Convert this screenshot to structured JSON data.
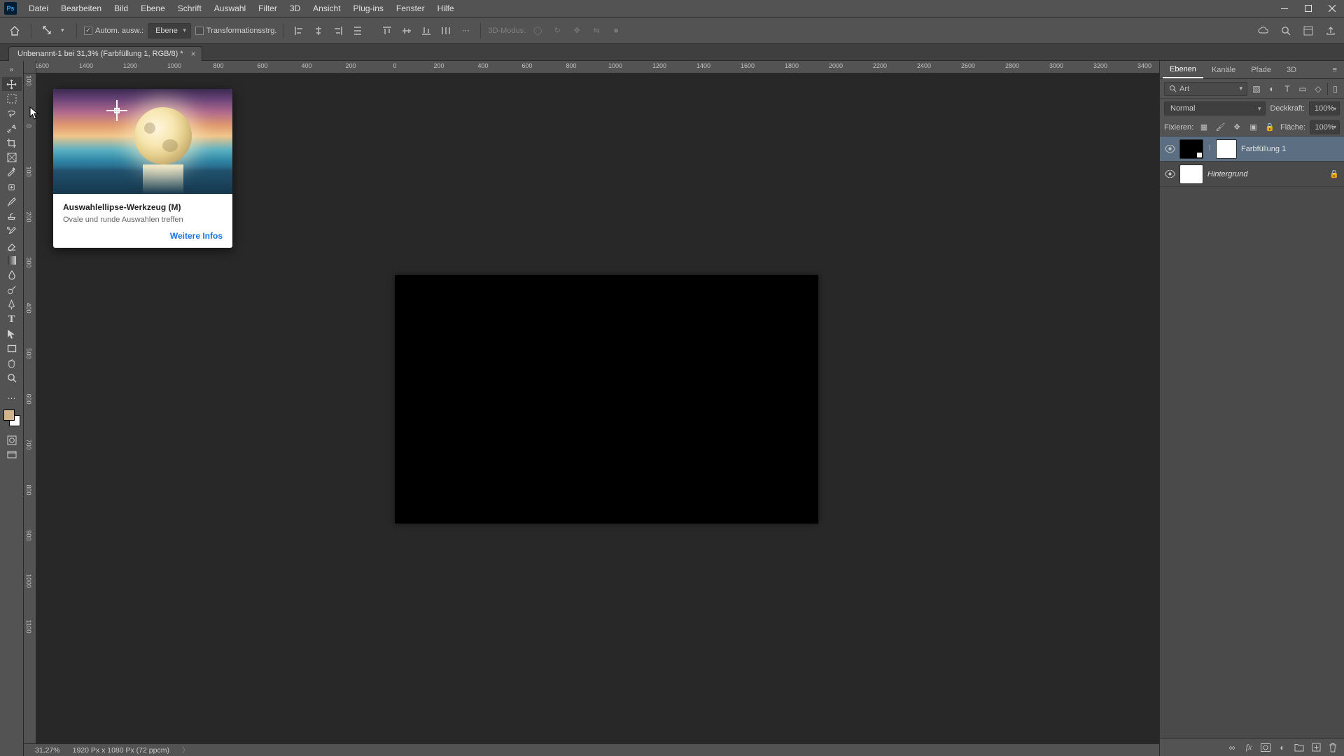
{
  "menu": {
    "items": [
      "Datei",
      "Bearbeiten",
      "Bild",
      "Ebene",
      "Schrift",
      "Auswahl",
      "Filter",
      "3D",
      "Ansicht",
      "Plug-ins",
      "Fenster",
      "Hilfe"
    ]
  },
  "options": {
    "auto_select_label": "Autom. ausw.:",
    "target_dropdown": "Ebene",
    "transform_label": "Transformationsstrg.",
    "mode_3d_label": "3D-Modus:"
  },
  "doc_tab": {
    "title": "Unbenannt-1 bei 31,3% (Farbfüllung 1, RGB/8) *"
  },
  "ruler_h": [
    "-1600",
    "-1400",
    "-1200",
    "-1000",
    "-800",
    "-600",
    "-400",
    "-200",
    "0",
    "200",
    "400",
    "600",
    "800",
    "1000",
    "1200",
    "1400",
    "1600",
    "1800",
    "2000",
    "2200",
    "2400",
    "2600",
    "2800",
    "3000",
    "3200",
    "3400"
  ],
  "ruler_v": [
    "-100",
    "0",
    "100",
    "200",
    "300",
    "400",
    "500",
    "600",
    "700",
    "800",
    "900",
    "1000",
    "1100"
  ],
  "tooltip": {
    "title": "Auswahlellipse-Werkzeug (M)",
    "desc": "Ovale und runde Auswahlen treffen",
    "link": "Weitere Infos"
  },
  "status": {
    "zoom": "31,27%",
    "info": "1920 Px x 1080 Px (72 ppcm)"
  },
  "panel": {
    "tabs": [
      "Ebenen",
      "Kanäle",
      "Pfade",
      "3D"
    ],
    "search_placeholder": "Art",
    "blend_mode": "Normal",
    "opacity_label": "Deckkraft:",
    "opacity_value": "100%",
    "lock_label": "Fixieren:",
    "fill_label": "Fläche:",
    "fill_value": "100%",
    "layers": [
      {
        "name": "Farbfüllung 1",
        "locked": false
      },
      {
        "name": "Hintergrund",
        "locked": true
      }
    ]
  }
}
